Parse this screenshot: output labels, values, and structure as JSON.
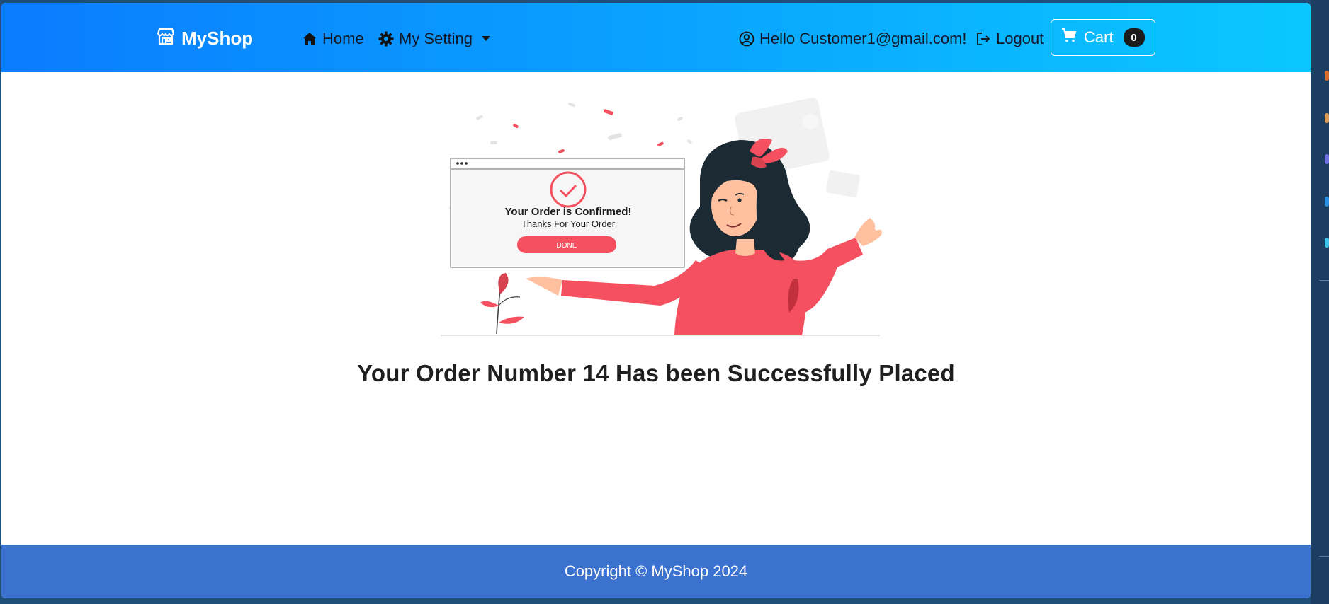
{
  "navbar": {
    "brand": "MyShop",
    "home_label": "Home",
    "settings_label": "My Setting",
    "greeting": "Hello Customer1@gmail.com!",
    "logout_label": "Logout",
    "cart_label": "Cart",
    "cart_count": "0"
  },
  "illustration": {
    "card_title": "Your Order is Confirmed!",
    "card_subtitle": "Thanks For Your Order",
    "card_button": "DONE"
  },
  "main": {
    "message": "Your Order Number 14 Has been Successfully Placed"
  },
  "footer": {
    "copyright": "Copyright © MyShop 2024"
  },
  "colors": {
    "navbar_start": "#0a7cff",
    "navbar_end": "#0ac8ff",
    "footer": "#3b72cf",
    "accent_red": "#f4505f"
  },
  "icons": {
    "brand": "store-icon",
    "home": "home-icon",
    "settings": "gear-icon",
    "settings_caret": "caret-down-icon",
    "user": "user-circle-icon",
    "logout": "logout-icon",
    "cart": "cart-icon"
  }
}
